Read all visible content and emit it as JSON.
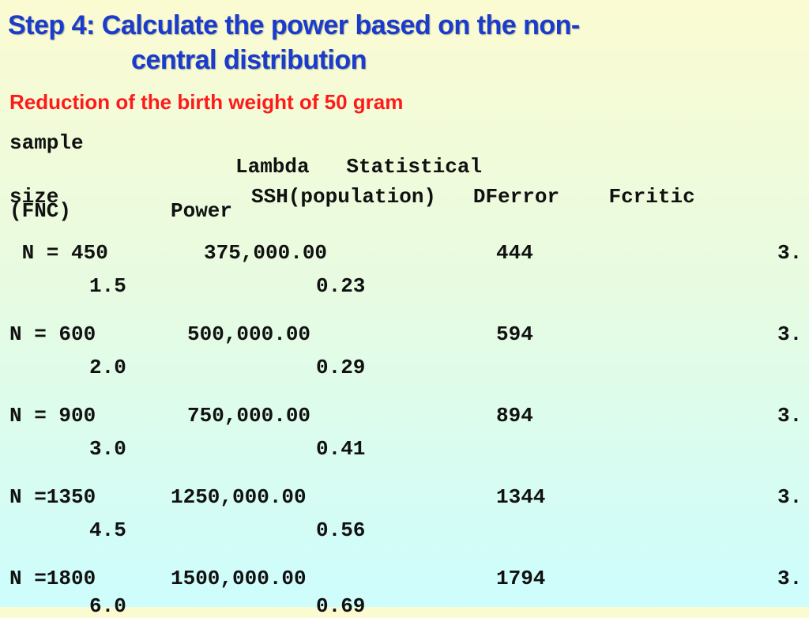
{
  "title_line1": "Step 4:  Calculate the power based on the non-",
  "title_line2": "central distribution",
  "subtitle": "Reduction of the birth weight of 50 gram",
  "headers": {
    "sample": "sample",
    "size": "size",
    "lambda_stat": "Lambda   Statistical",
    "ssh_df_f": "SSH(population)   DFerror    Fcritic",
    "fnc": "(FNC)",
    "power": "Power"
  },
  "rows": [
    {
      "n": " N = 450",
      "ssh": "375,000.00",
      "df": "444",
      "fcrit": "3.",
      "lambda": "1.5",
      "power": "0.23"
    },
    {
      "n": "N = 600",
      "ssh": "500,000.00",
      "df": "594",
      "fcrit": "3.",
      "lambda": "2.0",
      "power": "0.29"
    },
    {
      "n": "N = 900",
      "ssh": "750,000.00",
      "df": "894",
      "fcrit": "3.",
      "lambda": "3.0",
      "power": "0.41"
    },
    {
      "n": "N =1350",
      "ssh": "1250,000.00",
      "df": "1344",
      "fcrit": "3.",
      "lambda": "4.5",
      "power": "0.56"
    },
    {
      "n": "N =1800",
      "ssh": "1500,000.00",
      "df": "1794",
      "fcrit": "3.",
      "lambda": "6.0",
      "power": "0.69"
    }
  ]
}
